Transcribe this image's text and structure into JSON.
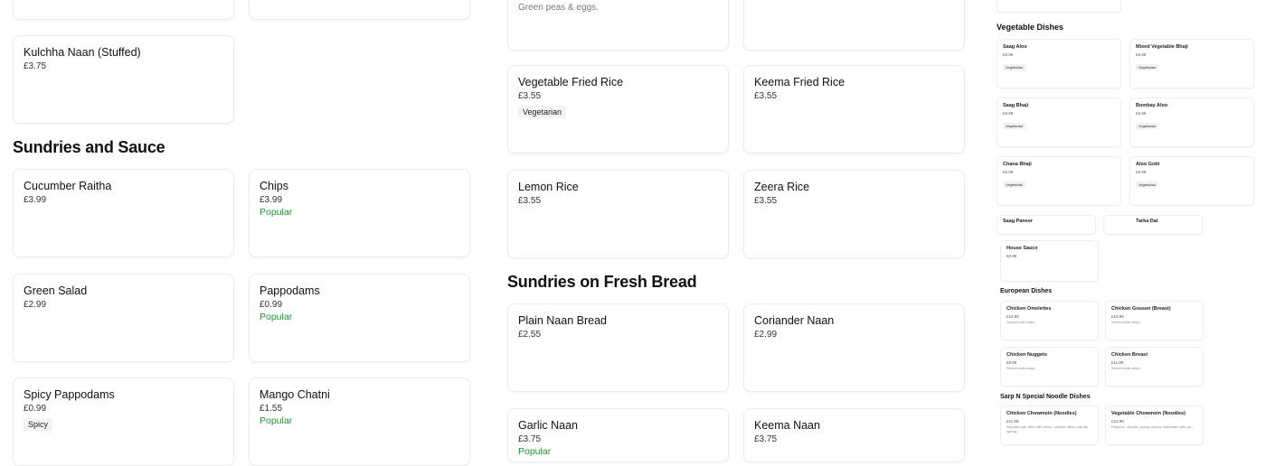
{
  "left": {
    "top_stubs": [
      "",
      ""
    ],
    "kulchha": {
      "name": "Kulchha Naan (Stuffed)",
      "price": "£3.75"
    },
    "sundries_title": "Sundries and Sauce",
    "sundries": [
      {
        "name": "Cucumber Raitha",
        "price": "£3.99",
        "badge": ""
      },
      {
        "name": "Chips",
        "price": "£3.99",
        "badge": "Popular"
      },
      {
        "name": "Green Salad",
        "price": "£2.99",
        "badge": ""
      },
      {
        "name": "Pappodams",
        "price": "£0.99",
        "badge": "Popular"
      },
      {
        "name": "Spicy Pappodams",
        "price": "£0.99",
        "tag": "Spicy"
      },
      {
        "name": "Mango Chatni",
        "price": "£1.55",
        "badge": "Popular"
      }
    ]
  },
  "middle": {
    "top_desc": "Green peas & eggs.",
    "rice": [
      {
        "name": "Vegetable Fried Rice",
        "price": "£3.55",
        "tag": "Vegetarian"
      },
      {
        "name": "Keema Fried Rice",
        "price": "£3.55"
      },
      {
        "name": "Lemon Rice",
        "price": "£3.55"
      },
      {
        "name": "Zeera Rice",
        "price": "£3.55"
      }
    ],
    "bread_title": "Sundries on Fresh Bread",
    "bread": [
      {
        "name": "Plain Naan Bread",
        "price": "£2.55"
      },
      {
        "name": "Coriander Naan",
        "price": "£2.99"
      },
      {
        "name": "Garlic Naan",
        "price": "£3.75",
        "badge": "Popular"
      },
      {
        "name": "Keema Naan",
        "price": "£3.75"
      }
    ]
  },
  "mini": {
    "veg_title": "Vegetable Dishes",
    "veg": [
      {
        "name": "Saag Aloo",
        "price": "£6.99",
        "tag": "Vegetarian"
      },
      {
        "name": "Mixed Vegetable Bhaji",
        "price": "£6.99",
        "tag": "Vegetarian"
      },
      {
        "name": "Saag Bhaji",
        "price": "£6.99",
        "tag": "Vegetarian"
      },
      {
        "name": "Bombay Aloo",
        "price": "£6.99",
        "tag": "Vegetarian"
      },
      {
        "name": "Chana Bhaji",
        "price": "£6.99",
        "tag": "Vegetarian"
      },
      {
        "name": "Aloo Gobi",
        "price": "£6.99",
        "tag": "Vegetarian"
      },
      {
        "name": "Saag Paneer",
        "price": ""
      },
      {
        "name": "Tarka Dal",
        "price": ""
      }
    ],
    "house_sauce": {
      "name": "House Sauce",
      "price": "£0.99"
    },
    "euro_title": "European Dishes",
    "euro": [
      {
        "name": "Chicken Omelettes",
        "price": "£10.99",
        "desc": "Served with chips."
      },
      {
        "name": "Chicken Gousen (Breast)",
        "price": "£10.99",
        "desc": "Served with chips."
      },
      {
        "name": "Chicken Nuggets",
        "price": "£9.99",
        "desc": "Served with chips."
      },
      {
        "name": "Chicken Breast",
        "price": "£11.99",
        "desc": "Served with chips."
      }
    ],
    "noodle_title": "Sarp N Special Noodle Dishes",
    "noodle": [
      {
        "name": "Chicken Chowmein (Noodles)",
        "price": "£11.99",
        "desc": "Noodles pan fried with onion, chicken tikka, carrots, spring..."
      },
      {
        "name": "Vegetable Chowmein (Noodles)",
        "price": "£10.99",
        "desc": "Peppers, carrots, spring onions marinated with sp..."
      }
    ]
  }
}
